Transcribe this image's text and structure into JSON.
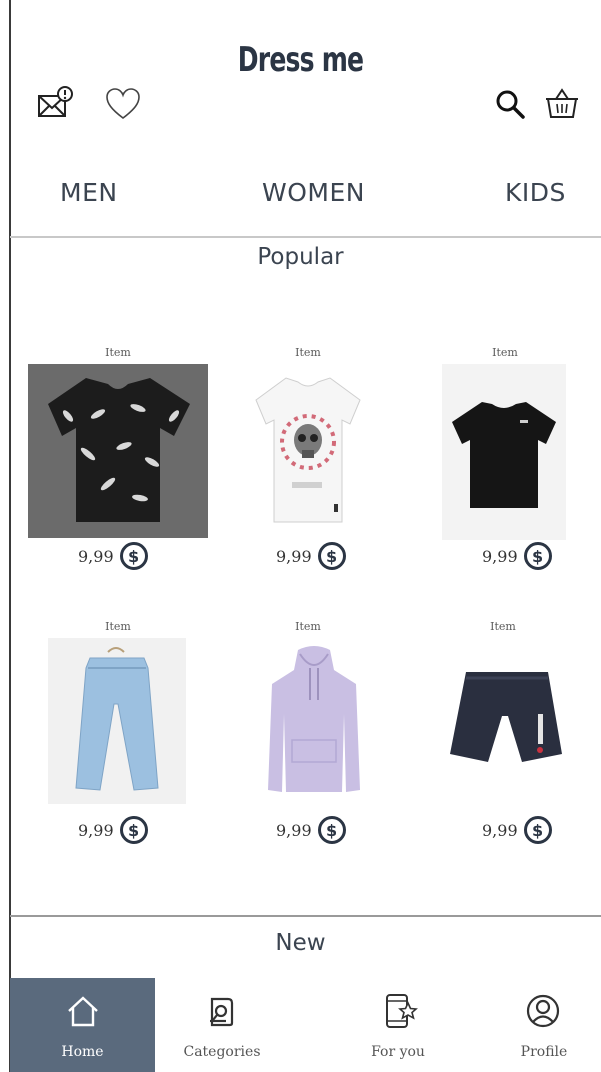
{
  "app": {
    "title": "Dress me"
  },
  "header": {
    "icons": [
      "mail-alert-icon",
      "heart-icon",
      "search-icon",
      "basket-icon"
    ]
  },
  "categories": [
    "MEN",
    "WOMEN",
    "KIDS"
  ],
  "sections": {
    "popular": "Popular",
    "new": "New"
  },
  "products": [
    {
      "label": "Item",
      "price": "9,99",
      "currency_symbol": "$",
      "image": "black-feather-tshirt"
    },
    {
      "label": "Item",
      "price": "9,99",
      "currency_symbol": "$",
      "image": "white-skull-tshirt"
    },
    {
      "label": "Item",
      "price": "9,99",
      "currency_symbol": "$",
      "image": "black-tshirt"
    },
    {
      "label": "Item",
      "price": "9,99",
      "currency_symbol": "$",
      "image": "light-blue-jeans"
    },
    {
      "label": "Item",
      "price": "9,99",
      "currency_symbol": "$",
      "image": "lavender-hoodie"
    },
    {
      "label": "Item",
      "price": "9,99",
      "currency_symbol": "$",
      "image": "navy-shorts"
    }
  ],
  "bottom_nav": [
    {
      "label": "Home",
      "icon": "home-icon",
      "active": true
    },
    {
      "label": "Categories",
      "icon": "categories-search-icon",
      "active": false
    },
    {
      "label": "For you",
      "icon": "phone-star-icon",
      "active": false
    },
    {
      "label": "Profile",
      "icon": "profile-icon",
      "active": false
    }
  ],
  "colors": {
    "accent": "#5a6a7d",
    "text": "#2b3544",
    "divider": "#c8c8c8"
  }
}
